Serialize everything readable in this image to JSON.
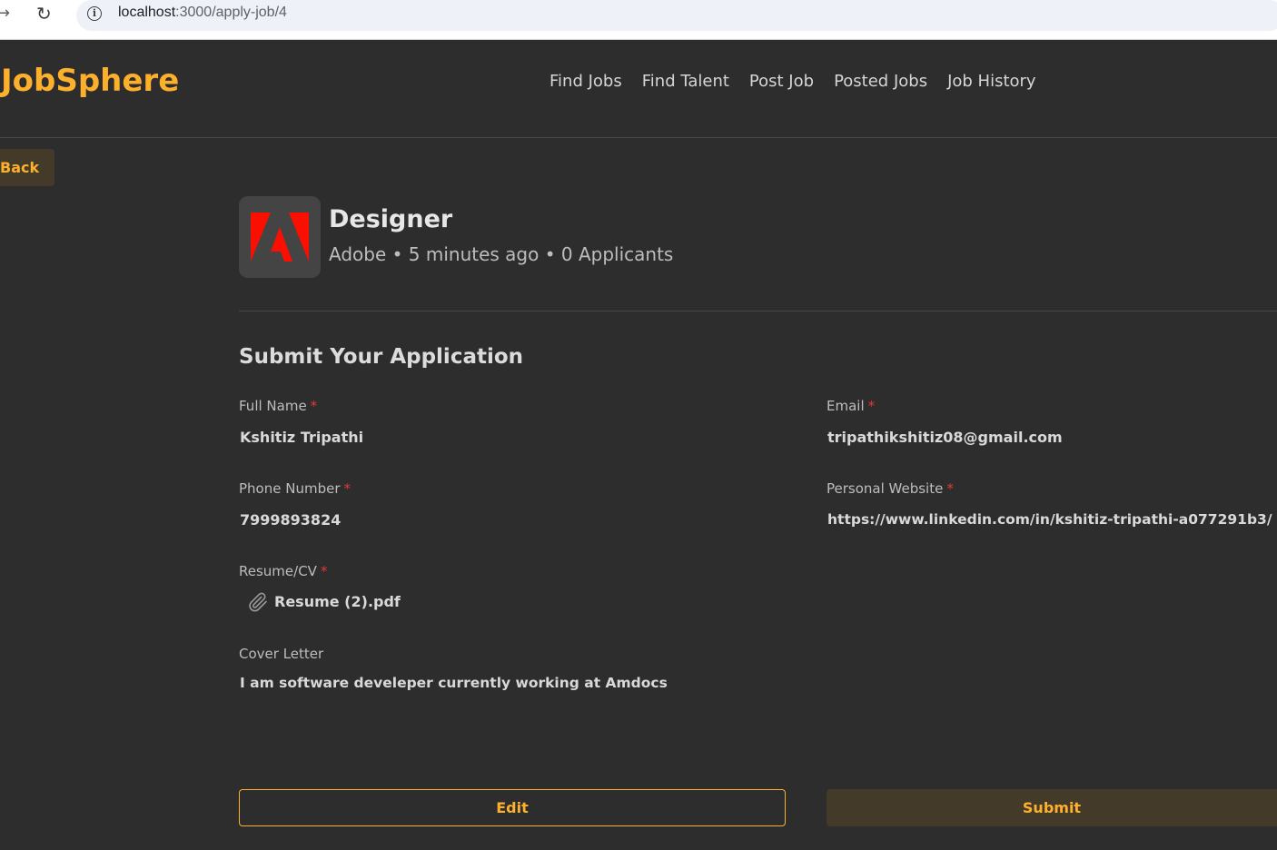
{
  "browser": {
    "url_host": "localhost",
    "url_path": ":3000/apply-job/4"
  },
  "header": {
    "logo": "JobSphere",
    "nav": [
      "Find Jobs",
      "Find Talent",
      "Post Job",
      "Posted Jobs",
      "Job History"
    ]
  },
  "back_label": "Back",
  "job": {
    "title": "Designer",
    "meta": "Adobe • 5 minutes ago • 0 Applicants",
    "logo_icon": "adobe-logo-icon",
    "logo_color": "#fa0f00"
  },
  "form": {
    "title": "Submit Your Application",
    "required_mark": "*",
    "full_name": {
      "label": "Full Name",
      "value": "Kshitiz Tripathi"
    },
    "email": {
      "label": "Email",
      "value": "tripathikshitiz08@gmail.com"
    },
    "phone": {
      "label": "Phone Number",
      "value": "7999893824"
    },
    "website": {
      "label": "Personal Website",
      "value": "https://www.linkedin.com/in/kshitiz-tripathi-a077291b3/"
    },
    "resume": {
      "label": "Resume/CV",
      "file": "Resume (2).pdf"
    },
    "cover_letter": {
      "label": "Cover Letter",
      "value": "I am software develeper currently working at Amdocs"
    }
  },
  "buttons": {
    "edit": "Edit",
    "submit": "Submit"
  },
  "colors": {
    "accent": "#fdb02b",
    "background": "#2d2d2d",
    "required": "#e53935"
  }
}
